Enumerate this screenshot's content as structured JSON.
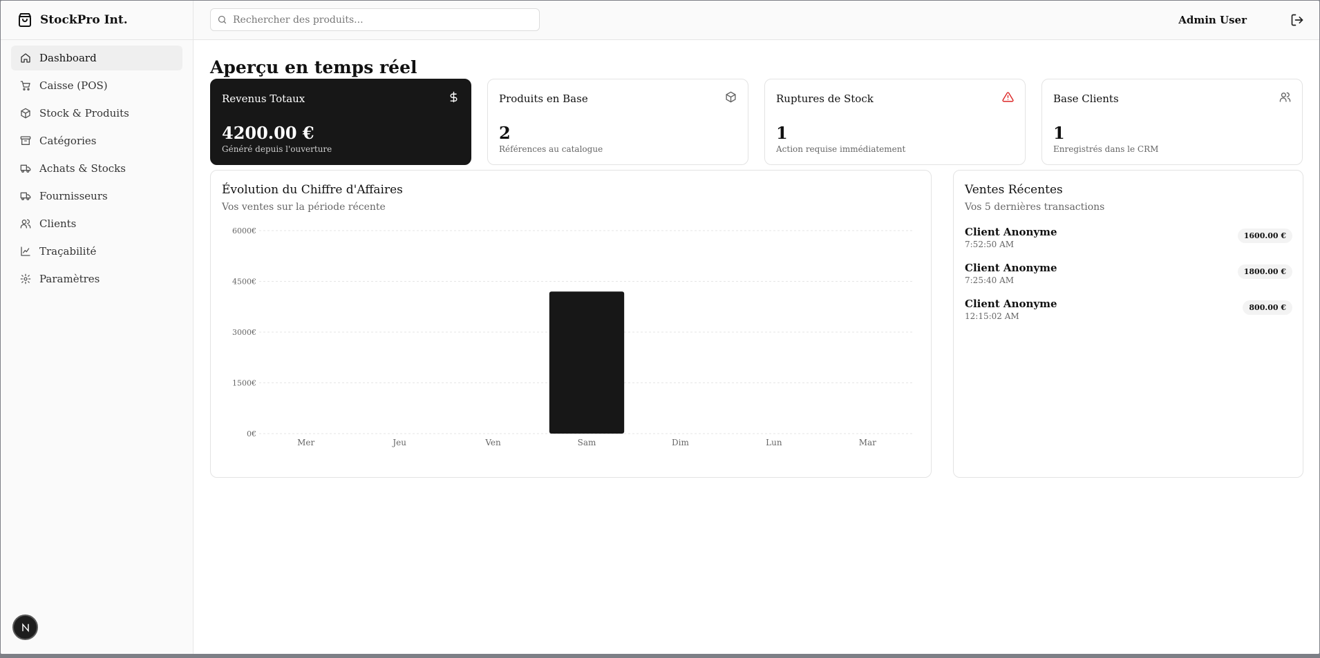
{
  "app": {
    "brand": "StockPro Int."
  },
  "sidebar": {
    "items": [
      {
        "label": "Dashboard",
        "icon": "home-icon",
        "active": true
      },
      {
        "label": "Caisse (POS)",
        "icon": "cart-icon"
      },
      {
        "label": "Stock & Produits",
        "icon": "package-icon"
      },
      {
        "label": "Catégories",
        "icon": "archive-icon"
      },
      {
        "label": "Achats & Stocks",
        "icon": "truck-icon"
      },
      {
        "label": "Fournisseurs",
        "icon": "truck-icon"
      },
      {
        "label": "Clients",
        "icon": "users-icon"
      },
      {
        "label": "Traçabilité",
        "icon": "line-chart-icon"
      },
      {
        "label": "Paramètres",
        "icon": "settings-icon"
      }
    ]
  },
  "header": {
    "search_placeholder": "Rechercher des produits...",
    "user": "Admin User"
  },
  "page": {
    "title": "Aperçu en temps réel"
  },
  "cards": [
    {
      "title": "Revenus Totaux",
      "value": "4200.00 €",
      "sub": "Généré depuis l'ouverture",
      "icon": "dollar-icon",
      "dark": true
    },
    {
      "title": "Produits en Base",
      "value": "2",
      "sub": "Références au catalogue",
      "icon": "package-icon"
    },
    {
      "title": "Ruptures de Stock",
      "value": "1",
      "sub": "Action requise immédiatement",
      "icon": "alert-triangle-icon",
      "icon_color": "#dc2626"
    },
    {
      "title": "Base Clients",
      "value": "1",
      "sub": "Enregistrés dans le CRM",
      "icon": "users-icon"
    }
  ],
  "revenue_panel": {
    "title": "Évolution du Chiffre d'Affaires",
    "subtitle": "Vos ventes sur la période récente"
  },
  "chart_data": {
    "type": "bar",
    "categories": [
      "Mer",
      "Jeu",
      "Ven",
      "Sam",
      "Dim",
      "Lun",
      "Mar"
    ],
    "values": [
      0,
      0,
      0,
      4200,
      0,
      0,
      0
    ],
    "yticks": [
      "0€",
      "1500€",
      "3000€",
      "4500€",
      "6000€"
    ],
    "ylim": [
      0,
      6000
    ],
    "grid": true,
    "bar_color": "#171717"
  },
  "sales_panel": {
    "title": "Ventes Récentes",
    "subtitle": "Vos 5 dernières transactions",
    "sales": [
      {
        "client": "Client Anonyme",
        "time": "7:52:50 AM",
        "amount": "1600.00 €"
      },
      {
        "client": "Client Anonyme",
        "time": "7:25:40 AM",
        "amount": "1800.00 €"
      },
      {
        "client": "Client Anonyme",
        "time": "12:15:02 AM",
        "amount": "800.00 €"
      }
    ]
  }
}
